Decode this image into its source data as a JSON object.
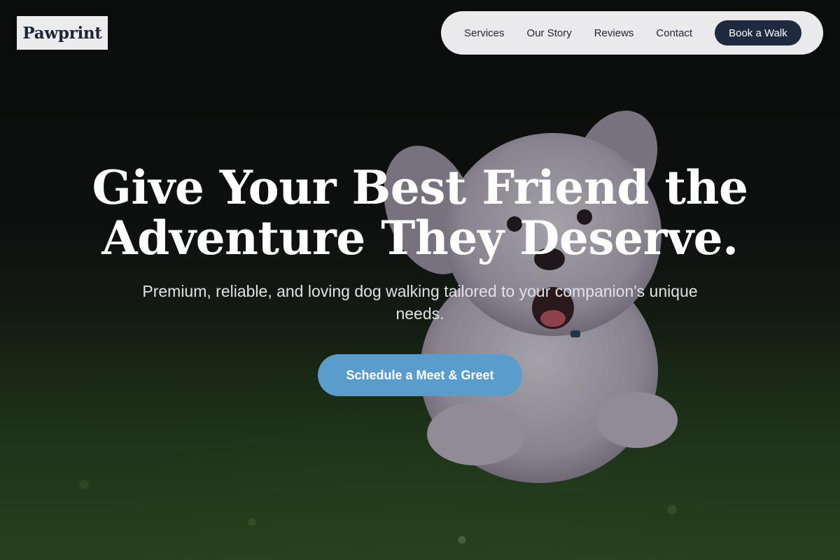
{
  "brand": {
    "logo": "Pawprint"
  },
  "nav": {
    "links": [
      "Services",
      "Our Story",
      "Reviews",
      "Contact"
    ],
    "cta": "Book a Walk"
  },
  "hero": {
    "headline_line1": "Give Your Best Friend the",
    "headline_line2": "Adventure They Deserve.",
    "subheadline": "Premium, reliable, and loving dog walking tailored to your companion's unique needs.",
    "cta": "Schedule a Meet & Greet",
    "background_subject": "white fluffy dog running on grass"
  },
  "colors": {
    "nav_background": "#eaeaec",
    "nav_cta": "#1f2a3f",
    "hero_cta": "#5a9dcc",
    "text_dark": "#1e2535"
  }
}
